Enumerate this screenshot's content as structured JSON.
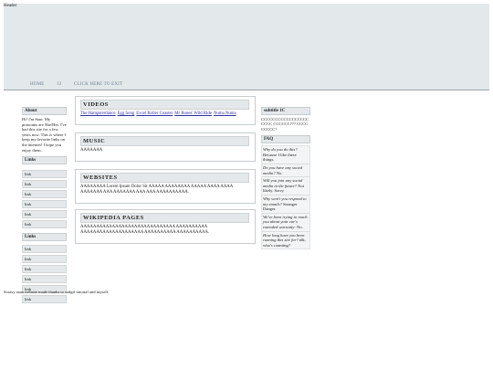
{
  "header": {
    "label": "Header"
  },
  "nav": {
    "home": "HOME",
    "page": "13",
    "exit": "CLICK HERE TO EXIT"
  },
  "about": {
    "title": "About",
    "text": "Hi! I'm Stan. My pronouns are She/Her. I've had this site for a few years now. This is where I keep my favorite links on the internet! I hope you enjoy them."
  },
  "links1": {
    "title": "Links",
    "items": [
      "link",
      "link",
      "link",
      "link",
      "link",
      "link"
    ]
  },
  "links2": {
    "title": "Links",
    "items": [
      "link",
      "link",
      "link",
      "link",
      "link",
      "link"
    ]
  },
  "videos": {
    "title": "VIDEOS",
    "links": [
      "The Hampsterdance",
      "Egg Song",
      "Excel Roller Coaster",
      "Mr Bones' Wild Ride",
      "Numa Numa"
    ]
  },
  "music": {
    "title": "MUSIC",
    "text": "AAAAAAA"
  },
  "websites": {
    "title": "WEBSITES",
    "text": "AAAAAAAA Lorem Ipsum Dolor Sit AAAAA AAAAAAAA AAAAA AAAA AAAA AAAAAAA AAA AAAAAAA AAA AAA AAAAAAAAAA."
  },
  "wikipedia": {
    "title": "WIKIPEDIA PAGES",
    "text": "AAAAAAAAAAAAAAAAAAAAAAAAAAAAAA AAAAAAAAAA AAAAAAAAAAAAAAAAAAAA AAAAAAAAAA AAAAAAAAAA."
  },
  "subtitle": {
    "title": "subtitle 1C",
    "text": "CCCCCCCCCCCCCCCCCCCCC CCCCCC??? CCCCCCCCC!"
  },
  "faq": {
    "title": "FAQ",
    "items": [
      {
        "q": "Why do you do this?",
        "a": "Because I like these things."
      },
      {
        "q": "Do you have any social media?",
        "a": "No."
      },
      {
        "q": "Will you join any social media in the future?",
        "a": "Not likely. Sorry."
      },
      {
        "q": "Why won't you respond to my emails?",
        "a": "Stranger Danger."
      },
      {
        "q": "We've been trying to reach you about your car's extended warranty-",
        "a": "No."
      },
      {
        "q": "How long have you been running this site for?",
        "a": "idk, who's counting?"
      }
    ]
  },
  "footer": {
    "text": "Sootsy aaaa website made thanks to sadgrl tutorial and myself."
  }
}
